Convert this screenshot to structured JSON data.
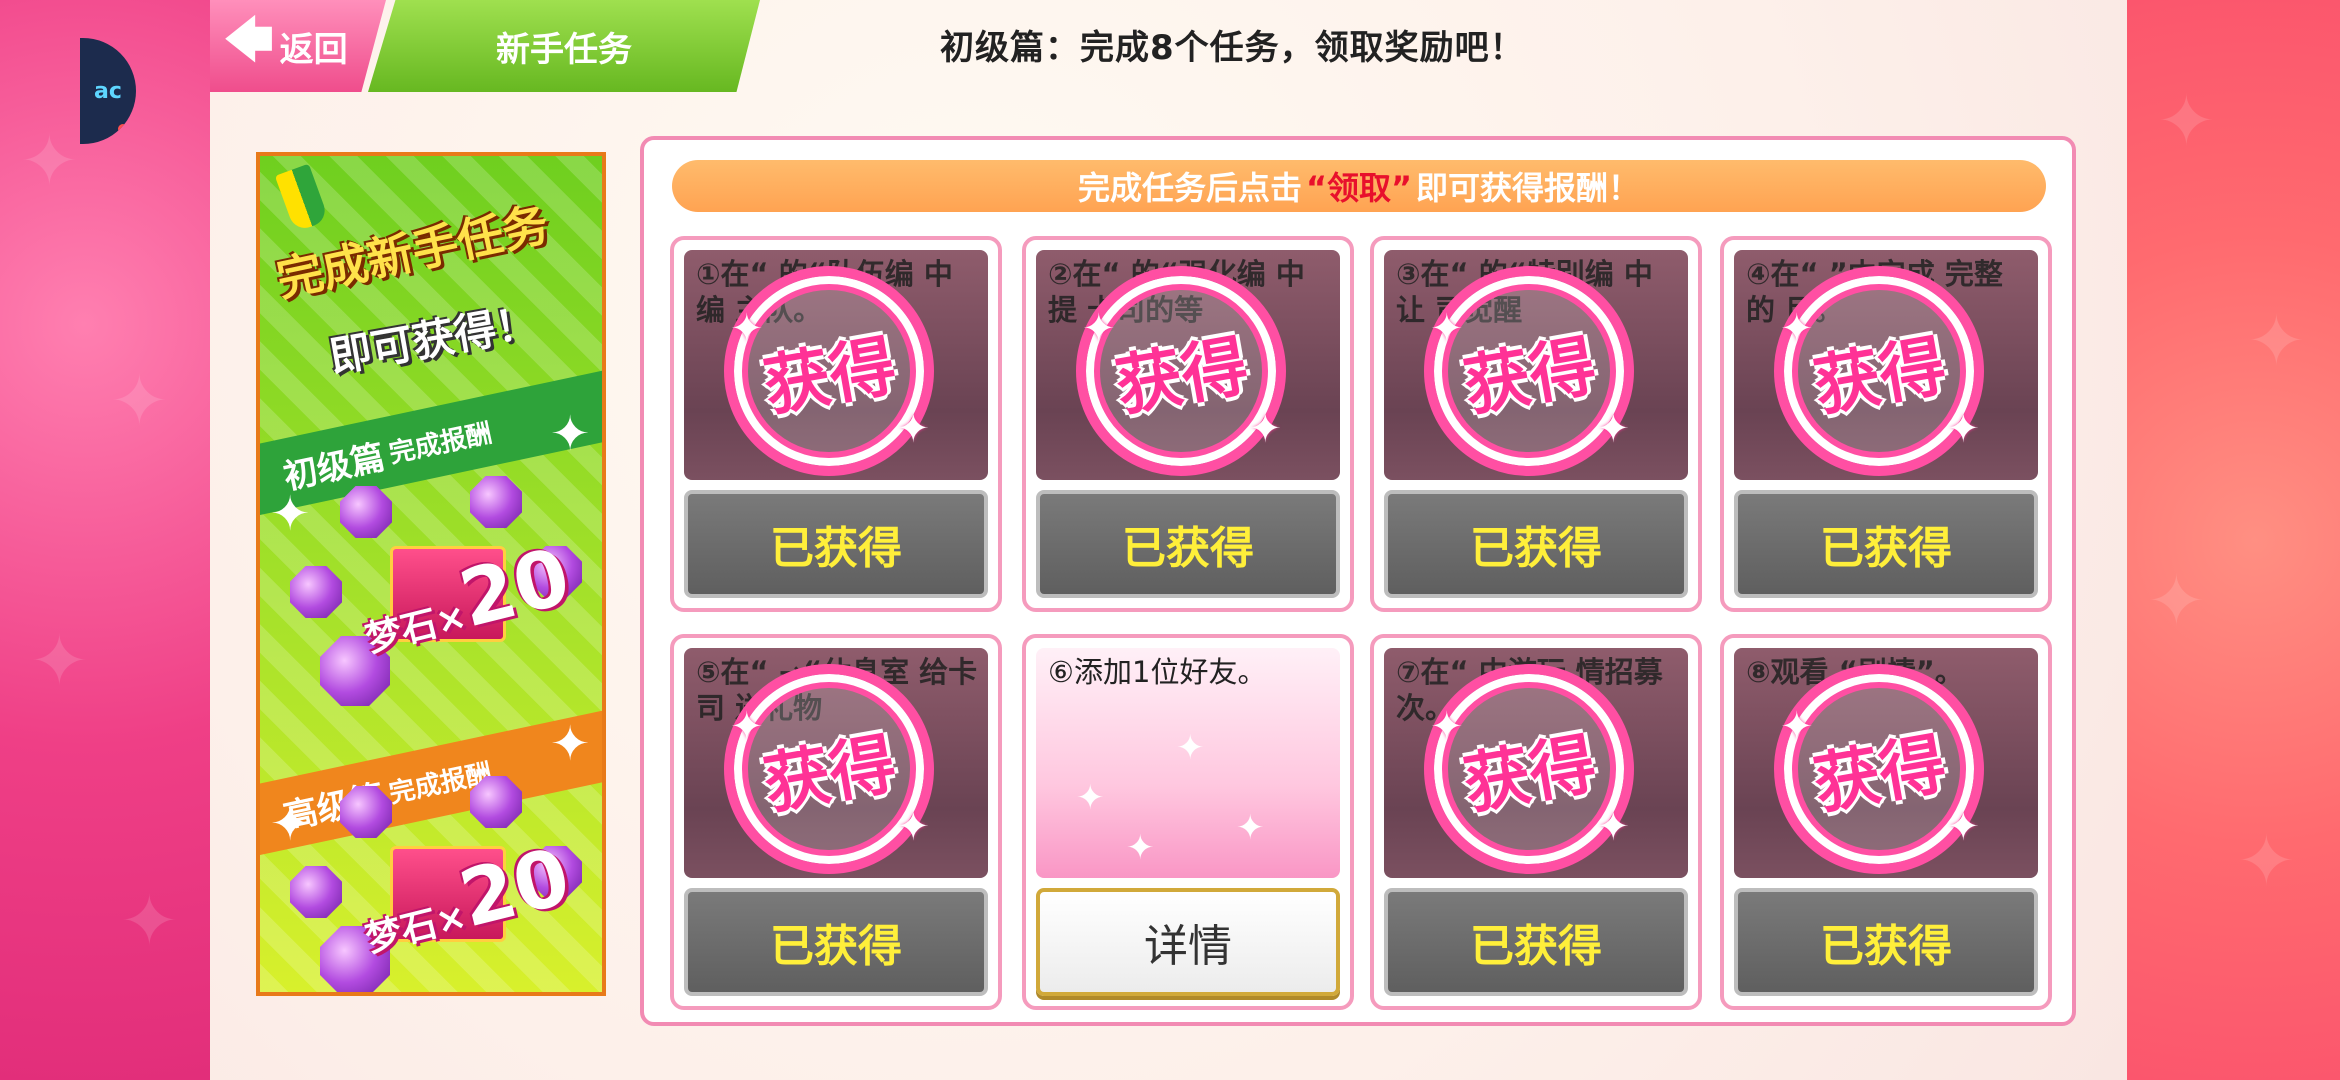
{
  "app": {
    "logo_text": "ac"
  },
  "header": {
    "back_label": "返回",
    "back_arrow": "arrow-left-icon",
    "tab_title": "新手任务",
    "heading": "初级篇：完成8个任务，领取奖励吧！"
  },
  "promo": {
    "line1": "完成新手任务",
    "line2": "即可获得！",
    "basic_label": "初级篇",
    "basic_suffix": "完成报酬",
    "advanced_label": "高级篇",
    "advanced_suffix": "完成报酬",
    "reward_name": "梦石",
    "reward_x": "×",
    "basic_amount": "20",
    "advanced_amount": "20"
  },
  "hint": {
    "before": "完成任务后点击",
    "highlight": "“领取”",
    "after": "即可获得报酬！"
  },
  "stamp_text": "获得",
  "tasks": [
    {
      "desc": "①在“ 的“队伍编 中编 主队。",
      "status": "已获得",
      "done": true
    },
    {
      "desc": "②在“ 的“强化编 中提 卡司的等",
      "status": "已获得",
      "done": true
    },
    {
      "desc": "③在“ 的“特别编 中让 司觉醒",
      "status": "已获得",
      "done": true
    },
    {
      "desc": "④在“ ”中完成 完整的 目。",
      "status": "已获得",
      "done": true
    },
    {
      "desc": "⑤在“ →“休息室 给卡司 送礼物",
      "status": "已获得",
      "done": true
    },
    {
      "desc": "⑥添加1位好友。",
      "status": "详情",
      "done": false
    },
    {
      "desc": "⑦在“ 中游玩 情招募 次。",
      "status": "已获得",
      "done": true
    },
    {
      "desc": "⑧观看 “剧情”。",
      "status": "已获得",
      "done": true
    }
  ],
  "colors": {
    "accent_pink": "#ff3296",
    "green_tab": "#67b821",
    "hint_orange": "#ffa352",
    "claimed_text": "#ffef3a"
  }
}
